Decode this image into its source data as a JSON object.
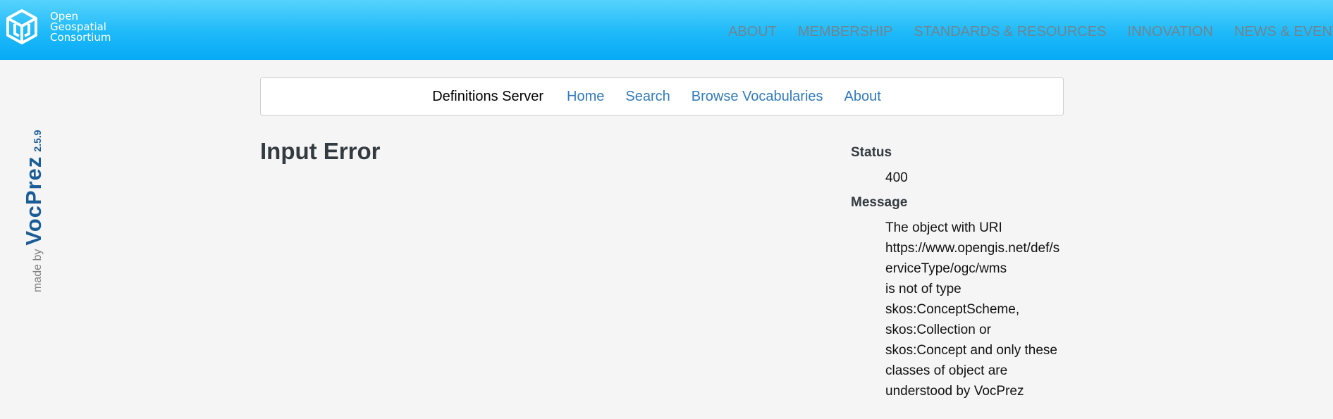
{
  "header": {
    "logo_lines": [
      "Open",
      "Geospatial",
      "Consortium"
    ],
    "nav_items": [
      "ABOUT",
      "MEMBERSHIP",
      "STANDARDS & RESOURCES",
      "INNOVATION",
      "NEWS & EVENTS"
    ]
  },
  "sidebar": {
    "made_by": "made by",
    "product": "VocPrez",
    "version": "2.5.9"
  },
  "subnav": {
    "brand": "Definitions Server",
    "links": [
      "Home",
      "Search",
      "Browse Vocabularies",
      "About"
    ]
  },
  "main": {
    "title": "Input Error"
  },
  "details": {
    "status_label": "Status",
    "status_value": "400",
    "message_label": "Message",
    "message_lines": [
      "The object with URI",
      "https://www.opengis.net/def/serviceType/ogc/wms",
      "is not of type",
      "skos:ConceptScheme,",
      "skos:Collection or",
      "skos:Concept and only these",
      "classes of object are",
      "understood by VocPrez"
    ]
  },
  "colors": {
    "header_top": "#56d3fd",
    "header_bottom": "#07aaf6",
    "link": "#337ab7",
    "brand_blue": "#1a5c96",
    "page_bg": "#f5f5f5"
  }
}
